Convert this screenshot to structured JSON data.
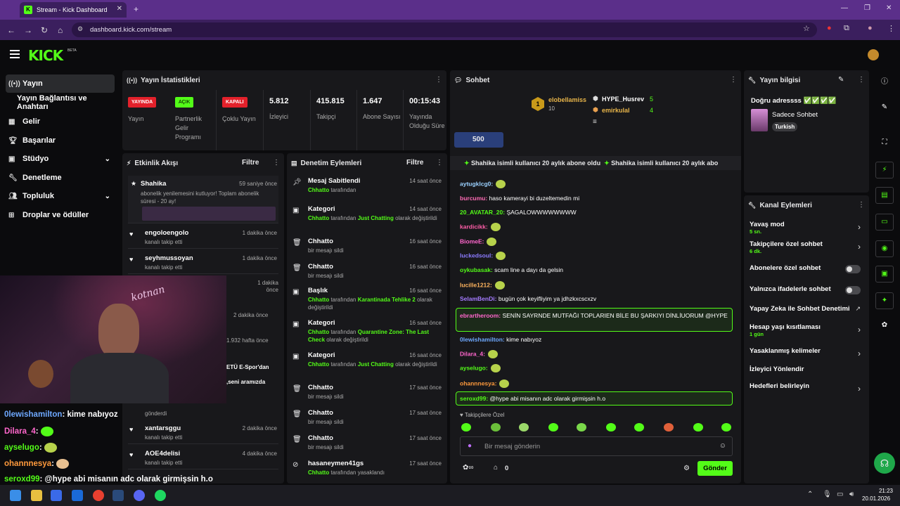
{
  "browser": {
    "tab_title": "Stream - Kick Dashboard",
    "url": "dashboard.kick.com/stream"
  },
  "header": {
    "logo": "KICK",
    "beta": "BETA"
  },
  "sidebar": {
    "items": [
      {
        "label": "Yayın",
        "icon": "broadcast-icon"
      },
      {
        "label": "Yayın Bağlantısı ve Anahtarı",
        "icon": ""
      },
      {
        "label": "Gelir",
        "icon": "revenue-icon"
      },
      {
        "label": "Başarılar",
        "icon": "trophy-icon"
      },
      {
        "label": "Stüdyo",
        "icon": "studio-icon"
      },
      {
        "label": "Denetleme",
        "icon": "wrench-icon"
      },
      {
        "label": "Topluluk",
        "icon": "community-icon"
      },
      {
        "label": "Droplar ve ödüller",
        "icon": "gift-icon"
      }
    ]
  },
  "stats": {
    "title": "Yayın İstatistikleri",
    "items": [
      {
        "badge": "YAYINDA",
        "label": "Yayın"
      },
      {
        "badge": "AÇIK",
        "label": "Partnerlik Gelir Programı"
      },
      {
        "badge": "KAPALI",
        "label": "Çoklu Yayın"
      },
      {
        "value": "5.812",
        "label": "İzleyici"
      },
      {
        "value": "415.815",
        "label": "Takipçi"
      },
      {
        "value": "1.647",
        "label": "Abone Sayısı"
      },
      {
        "value": "00:15:43",
        "label": "Yayında Olduğu Süre"
      }
    ]
  },
  "activity": {
    "title": "Etkinlik Akışı",
    "filter": "Filtre",
    "items": [
      {
        "name": "Shahika",
        "time": "59 saniye önce",
        "text": "abonelik yenilemesini kutluyor! Toplam abonelik süresi - 20 ay!"
      },
      {
        "name": "engoloengolo",
        "time": "1 dakika önce",
        "text": "kanalı takip etti"
      },
      {
        "name": "seyhmussoyan",
        "time": "1 dakika önce",
        "text": "kanalı takip etti"
      },
      {
        "name": "",
        "time": "1 dakika önce",
        "text": ""
      },
      {
        "name": "",
        "time": "2 dakika önce",
        "text": ""
      },
      {
        "name": "",
        "time": "1.932 hafta önce",
        "text": ""
      },
      {
        "name": "",
        "time": "",
        "text": "gönderdi"
      },
      {
        "name": "xantarsggu",
        "time": "2 dakika önce",
        "text": "kanalı takip etti"
      },
      {
        "name": "AOE4delisi",
        "time": "4 dakika önce",
        "text": "kanalı takip etti"
      }
    ],
    "partial1": "ETÜ E-Spor'dan",
    "partial2": ",seni aramızda"
  },
  "moderation": {
    "title": "Denetim Eylemleri",
    "filter": "Filtre",
    "items": [
      {
        "title": "Mesaj Sabitlendi",
        "time": "14 saat önce",
        "actor": "Chhatto",
        "rest": "tarafından"
      },
      {
        "title": "Kategori",
        "time": "14 saat önce",
        "actor": "Chhatto",
        "rest": "tarafından",
        "target": "Just Chatting",
        "tail": "olarak değiştirildi"
      },
      {
        "title": "Chhatto",
        "time": "16 saat önce",
        "rest": "bir mesajı sildi"
      },
      {
        "title": "Chhatto",
        "time": "16 saat önce",
        "rest": "bir mesajı sildi"
      },
      {
        "title": "Başlık",
        "time": "16 saat önce",
        "actor": "Chhatto",
        "rest": "tarafından",
        "target": "Karantinada Tehlike 2",
        "tail": "olarak değiştirildi"
      },
      {
        "title": "Kategori",
        "time": "16 saat önce",
        "actor": "Chhatto",
        "rest": "tarafından",
        "target": "Quarantine Zone: The Last Check",
        "tail": "olarak değiştirildi"
      },
      {
        "title": "Kategori",
        "time": "16 saat önce",
        "actor": "Chhatto",
        "rest": "tarafından",
        "target": "Just Chatting",
        "tail": "olarak değiştirildi"
      },
      {
        "title": "Chhatto",
        "time": "17 saat önce",
        "rest": "bir mesajı sildi"
      },
      {
        "title": "Chhatto",
        "time": "17 saat önce",
        "rest": "bir mesajı sildi"
      },
      {
        "title": "Chhatto",
        "time": "17 saat önce",
        "rest": "bir mesajı sildi"
      },
      {
        "title": "hasaneymen41gs",
        "time": "17 saat önce",
        "actor": "Chhatto",
        "rest": "tarafından yasaklandı"
      }
    ]
  },
  "chat": {
    "title": "Sohbet",
    "top1_name": "elobellamiss",
    "top1_val": "10",
    "top2_name": "HYPE_Husrev",
    "top2_val": "5",
    "top3_name": "emirkulal",
    "top3_val": "4",
    "rank": "1",
    "gift": "500",
    "marquee": "Shahika isimli kullanıcı 20 aylık abone oldu",
    "marquee2": "Shahika isimli kullanıcı 20 aylık abo",
    "messages": [
      {
        "user": "aytugklcg0:",
        "text": "",
        "color": "#9ad0ff"
      },
      {
        "user": "burcumu:",
        "text": "haso kamerayi bi duzeltemedin mi",
        "color": "#ff6bb5"
      },
      {
        "user": "20_AVATAR_20:",
        "text": "ŞAGALOWWWWWWWW",
        "color": "#53fc18"
      },
      {
        "user": "kardicikk:",
        "text": "",
        "color": "#ff5ea8"
      },
      {
        "user": "BiomeE:",
        "text": "",
        "color": "#ff66cc"
      },
      {
        "user": "luckedsoul:",
        "text": "",
        "color": "#8c7bff"
      },
      {
        "user": "oykubasak:",
        "text": "scam line a dayı da gelsin",
        "color": "#53fc18"
      },
      {
        "user": "lucille1212:",
        "text": "",
        "color": "#ffb45e"
      },
      {
        "user": "SelamBenDi:",
        "text": "bugün çok keyifliyim ya jdhzkxcscxzv",
        "color": "#a47bff"
      },
      {
        "user": "ebrartheroom:",
        "text": "SENİN SAYRNDE MUTFAĞI TOPLARIEN BİLE BU ŞARKIYI DİNLİUORUM @HYPE",
        "color": "#ff66cc"
      },
      {
        "user": "0lewishamilton:",
        "text": "kime nabıyoz",
        "color": "#6ea8ff"
      },
      {
        "user": "Dilara_4:",
        "text": "",
        "color": "#ff66cc"
      },
      {
        "user": "ayselugo:",
        "text": "",
        "color": "#53fc18"
      },
      {
        "user": "ohannnesya:",
        "text": "",
        "color": "#ff9a3c"
      },
      {
        "user": "seroxd99:",
        "text": "@hype abi misanın adc olarak girmişsin h.o",
        "color": "#53fc18"
      }
    ],
    "followers_only": "Takipçilere Özel",
    "input_placeholder": "Bir mesaj gönderin",
    "points": "0",
    "send": "Gönder"
  },
  "stream_info": {
    "title": "Yayın bilgisi",
    "stream_title": "Doğru adressss ✅✅✅✅",
    "category": "Sadece Sohbet",
    "tag": "Turkish"
  },
  "channel_actions": {
    "title": "Kanal Eylemleri",
    "items": [
      {
        "label": "Yavaş mod",
        "sub": "5 sn.",
        "ctl": "arrow"
      },
      {
        "label": "Takipçilere özel sohbet",
        "sub": "6 dk.",
        "ctl": "arrow"
      },
      {
        "label": "Abonelere özel sohbet",
        "sub": "",
        "ctl": "toggle"
      },
      {
        "label": "Yalnızca ifadelerle sohbet",
        "sub": "",
        "ctl": "toggle"
      },
      {
        "label": "Yapay Zeka ile Sohbet Denetimi",
        "sub": "",
        "ctl": "ext"
      },
      {
        "label": "Hesap yaşı kısıtlaması",
        "sub": "1 gün",
        "ctl": "arrow"
      },
      {
        "label": "Yasaklanmış kelimeler",
        "sub": "",
        "ctl": "arrow"
      },
      {
        "label": "İzleyici Yönlendir",
        "sub": "",
        "ctl": "none"
      },
      {
        "label": "Hedefleri belirleyin",
        "sub": "",
        "ctl": "arrow"
      }
    ]
  },
  "overlay": {
    "l1": "0lewishamilton",
    "l1t": ": kime nabıyoz",
    "l2": "Dilara_4",
    "l2t": ":",
    "l3": "ayselugo",
    "l3t": ":",
    "l4": "ohannnesya",
    "l4t": ":",
    "l5": "seroxd99",
    "l5t": ": @hype abi misanın adc olarak girmişsin h.o",
    "webcam_text": "kotnan"
  },
  "taskbar": {
    "time": "21:23",
    "date": "20.01.2026"
  },
  "colors": {
    "accent": "#53fc18",
    "panel": "#18181b",
    "live": "#e3212b",
    "browser": "#5b2f8a"
  }
}
